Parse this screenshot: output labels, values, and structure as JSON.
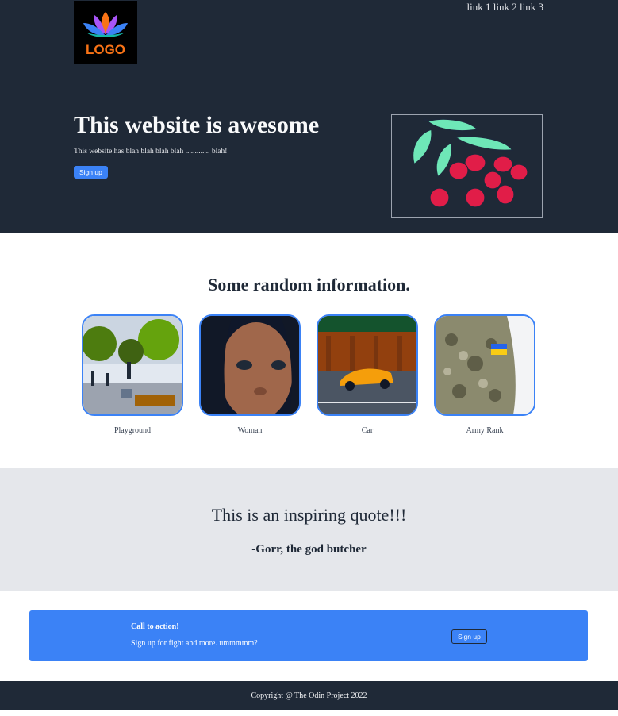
{
  "header": {
    "logo_text": "LOGO",
    "nav": [
      "link 1",
      "link 2",
      "link 3"
    ]
  },
  "hero": {
    "title": "This website is awesome",
    "subtitle": "This website has blah blah blah blah ............. blah!",
    "button_label": "Sign up"
  },
  "info": {
    "title": "Some random information.",
    "cards": [
      {
        "caption": "Playground"
      },
      {
        "caption": "Woman"
      },
      {
        "caption": "Car"
      },
      {
        "caption": "Army Rank"
      }
    ]
  },
  "quote": {
    "text": "This is an inspiring quote!!!",
    "author": "-Gorr, the god butcher"
  },
  "cta": {
    "title": "Call to action!",
    "text": "Sign up for fight and more. ummmmm?",
    "button_label": "Sign up"
  },
  "footer": {
    "copyright": "Copyright @ The Odin Project 2022"
  },
  "colors": {
    "dark": "#1f2937",
    "accent": "#3b82f6",
    "light_gray": "#e5e7eb"
  }
}
